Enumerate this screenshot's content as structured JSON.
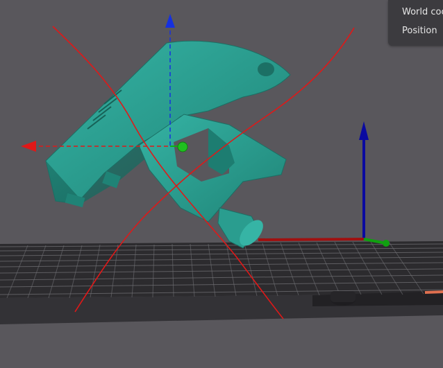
{
  "viewport": {
    "background": "#59575c",
    "bed_color": "#2b2a2d",
    "grid_color": "#6a6a6e",
    "model_color": "#2a9d8f",
    "axis_colors": {
      "x": "#d01010",
      "y": "#10b010",
      "z": "#1010d0"
    },
    "cancel_mark_color": "#e01818",
    "icons": [
      "rotate-gizmo",
      "cancel-x-mark",
      "origin-axes"
    ]
  },
  "coord_panel": {
    "items": [
      {
        "label": "World coo"
      },
      {
        "label": "Position"
      }
    ]
  }
}
